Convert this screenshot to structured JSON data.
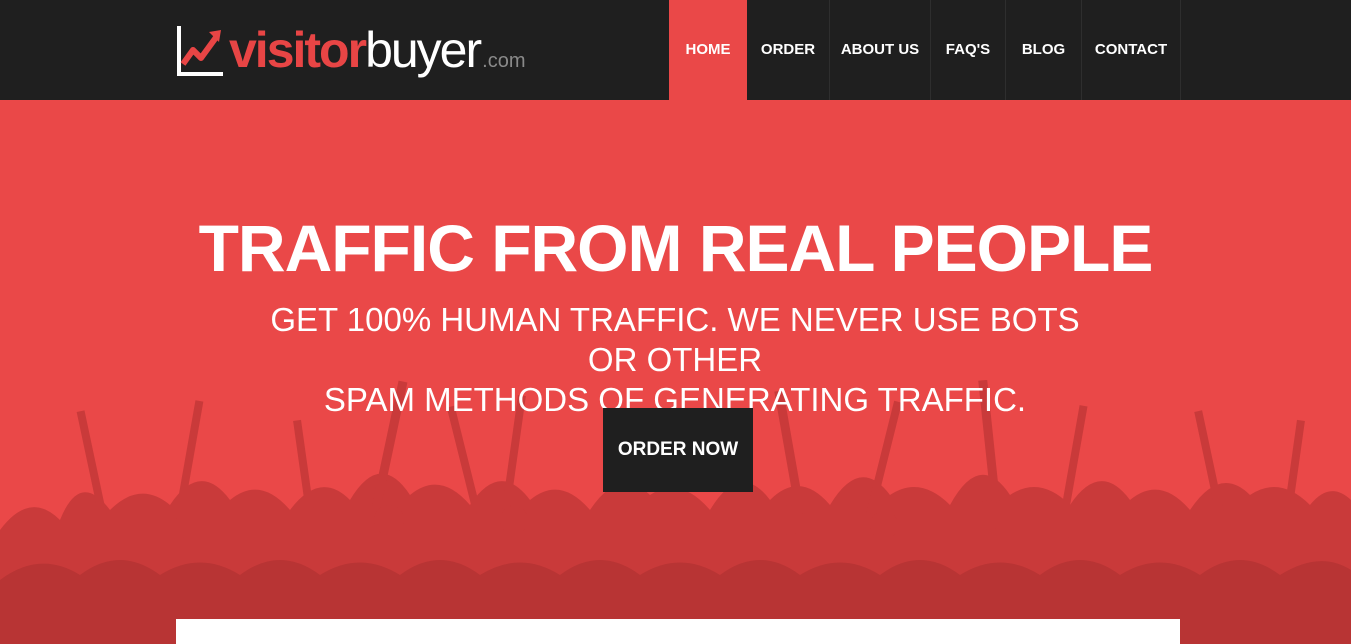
{
  "brand": {
    "name_part1": "visitor",
    "name_part2": "buyer",
    "name_suffix": ".com",
    "accent_color": "#e84545",
    "icon": "trending-up-chart-icon"
  },
  "nav": {
    "items": [
      {
        "label": "HOME",
        "active": true
      },
      {
        "label": "ORDER",
        "active": false
      },
      {
        "label": "ABOUT US",
        "active": false
      },
      {
        "label": "FAQ'S",
        "active": false
      },
      {
        "label": "BLOG",
        "active": false
      },
      {
        "label": "CONTACT",
        "active": false
      }
    ]
  },
  "hero": {
    "title": "TRAFFIC FROM REAL PEOPLE",
    "subtitle_line1": "GET 100% HUMAN TRAFFIC. WE NEVER USE BOTS OR OTHER",
    "subtitle_line2": "SPAM METHODS OF GENERATING TRAFFIC.",
    "cta_label": "ORDER NOW",
    "background_color": "#ea4848",
    "crowd_color": "#c93a3a"
  }
}
